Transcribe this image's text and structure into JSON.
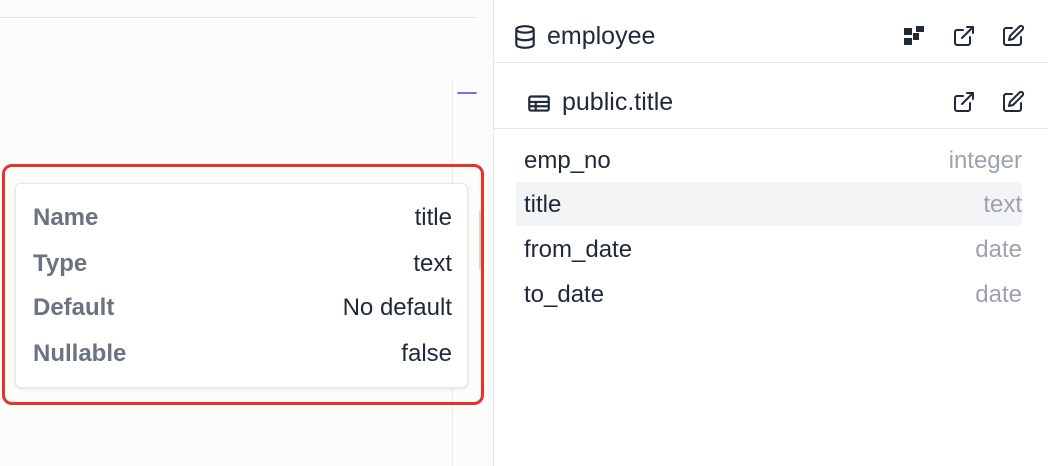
{
  "schema_panel": {
    "database_name": "employee",
    "database_icon": "database-icon",
    "database_actions": [
      {
        "icon": "schema-diagram-icon"
      },
      {
        "icon": "external-link-icon"
      },
      {
        "icon": "edit-icon"
      }
    ],
    "table_name": "public.title",
    "table_icon": "table-icon",
    "table_actions": [
      {
        "icon": "external-link-icon"
      },
      {
        "icon": "edit-icon"
      }
    ],
    "columns": [
      {
        "name": "emp_no",
        "type": "integer"
      },
      {
        "name": "title",
        "type": "text",
        "selected": true
      },
      {
        "name": "from_date",
        "type": "date"
      },
      {
        "name": "to_date",
        "type": "date"
      }
    ]
  },
  "column_info_card": {
    "rows": [
      {
        "label": "Name",
        "value": "title"
      },
      {
        "label": "Type",
        "value": "text"
      },
      {
        "label": "Default",
        "value": "No default"
      },
      {
        "label": "Nullable",
        "value": "false"
      }
    ]
  },
  "colors": {
    "highlight": "#e8322a",
    "accent": "#7c6ff0",
    "type_text": "#9ca3af",
    "selected_row": "#f3f4f6"
  }
}
